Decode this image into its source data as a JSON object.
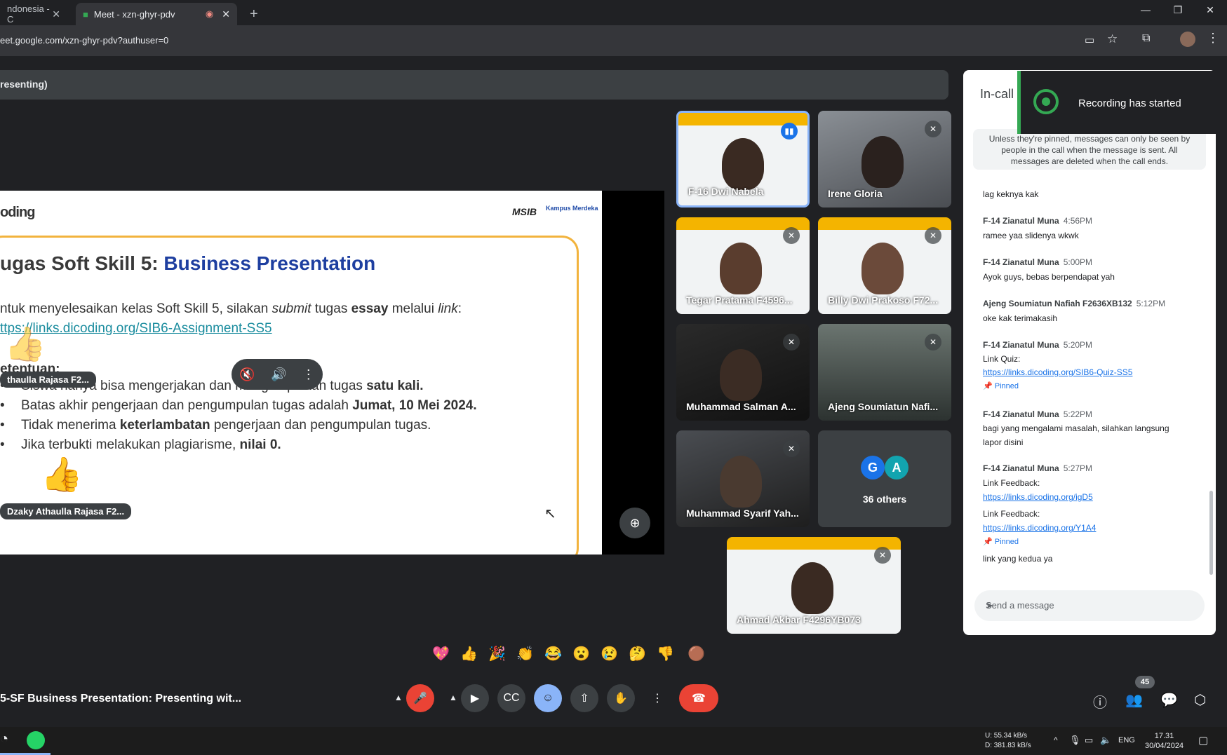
{
  "browser": {
    "tabs": [
      {
        "label": "ndonesia - C"
      },
      {
        "label": "Meet - xzn-ghyr-pdv"
      }
    ],
    "new_tab": "+",
    "url": "eet.google.com/xzn-ghyr-pdv?authuser=0",
    "window_controls": [
      "—",
      "❐",
      "✕"
    ]
  },
  "presentation_bar": {
    "label": "resenting)"
  },
  "slide": {
    "logo": "oding",
    "msib": "MSIB",
    "kampus": "Kampus Merdeka",
    "title_prefix": "ugas Soft Skill 5: ",
    "title_highlight": "Business Presentation",
    "intro_a": "ntuk menyelesaikan kelas Soft Skill 5, silakan ",
    "intro_b": "submit",
    "intro_c": " tugas ",
    "intro_d": "essay",
    "intro_e": " melalui ",
    "intro_f": "link",
    "intro_g": ":",
    "link": "ttps://links.dicoding.org/SIB6-Assignment-SS5",
    "ketentuan": "etentuan:",
    "rules": [
      {
        "a": "Siswa hanya bisa mengerjakan dan mengumpulkan tugas ",
        "b": "satu kali.",
        "c": ""
      },
      {
        "a": "Batas akhir pengerjaan dan pengumpulan tugas adalah ",
        "b": "Jumat, 10 Mei 2024.",
        "c": ""
      },
      {
        "a": "Tidak menerima ",
        "b": "keterlambatan",
        "c": " pengerjaan dan pengumpulan tugas."
      },
      {
        "a": "Jika terbukti melakukan plagiarisme, ",
        "b": "nilai 0.",
        "c": ""
      }
    ],
    "reaction_chip_1": "thaulla Rajasa F2...",
    "reaction_chip_2": "Dzaky Athaulla Rajasa F2..."
  },
  "tiles": [
    {
      "name": "F-16 Dwi Nabela"
    },
    {
      "name": "Irene Gloria"
    },
    {
      "name": "Tegar Pratama F4596..."
    },
    {
      "name": "Billy Dwi Prakoso F72..."
    },
    {
      "name": "Muhammad Salman A..."
    },
    {
      "name": "Ajeng Soumiatun Nafi..."
    },
    {
      "name": "Muhammad Syarif Yah..."
    },
    {
      "name": "36 others",
      "avatars": [
        "G",
        "A"
      ]
    },
    {
      "name": "Ahmad Akbar F4296YB073"
    }
  ],
  "chat": {
    "title": "In-call",
    "notice": "Unless they're pinned, messages can only be seen by people in the call when the message is sent. All messages are deleted when the call ends.",
    "messages": [
      {
        "text": "lag keknya kak"
      },
      {
        "author": "F-14 Zianatul Muna",
        "time": "4:56PM",
        "text": "ramee yaa slidenya wkwk"
      },
      {
        "author": "F-14 Zianatul Muna",
        "time": "5:00PM",
        "text": "Ayok guys, bebas berpendapat yah"
      },
      {
        "author": "Ajeng Soumiatun Nafiah F2636XB132",
        "time": "5:12PM",
        "text": "oke kak terimakasih"
      },
      {
        "author": "F-14 Zianatul Muna",
        "time": "5:20PM",
        "text": "Link Quiz:",
        "link": "https://links.dicoding.org/SIB6-Quiz-SS5",
        "pinned": "Pinned"
      },
      {
        "author": "F-14 Zianatul Muna",
        "time": "5:22PM",
        "text": "bagi yang mengalami masalah, silahkan langsung",
        "text2": "lapor disini"
      },
      {
        "author": "F-14 Zianatul Muna",
        "time": "5:27PM",
        "text": "Link Feedback:",
        "link": "https://links.dicoding.org/igD5",
        "text2": "Link Feedback:",
        "link2": "https://links.dicoding.org/Y1A4",
        "pinned": "Pinned",
        "text3": "link yang kedua ya"
      }
    ],
    "input_placeholder": "Send a message"
  },
  "toast": {
    "text": "Recording has started"
  },
  "reactions": [
    "💖",
    "👍",
    "🎉",
    "👏",
    "😂",
    "😮",
    "😢",
    "🤔",
    "👎",
    "🟤"
  ],
  "bottom": {
    "meeting_name": "5-SF Business Presentation: Presenting wit...",
    "people_count": "45"
  },
  "taskbar": {
    "net_up": "U:        55.34 kB/s",
    "net_down": "D:      381.83 kB/s",
    "lang": "ENG",
    "time": "17.31",
    "date": "30/04/2024"
  },
  "colors": {
    "accent": "#1a73e8",
    "end_call": "#ea4335",
    "recording": "#34a853",
    "slide_border": "#f2b33d"
  }
}
